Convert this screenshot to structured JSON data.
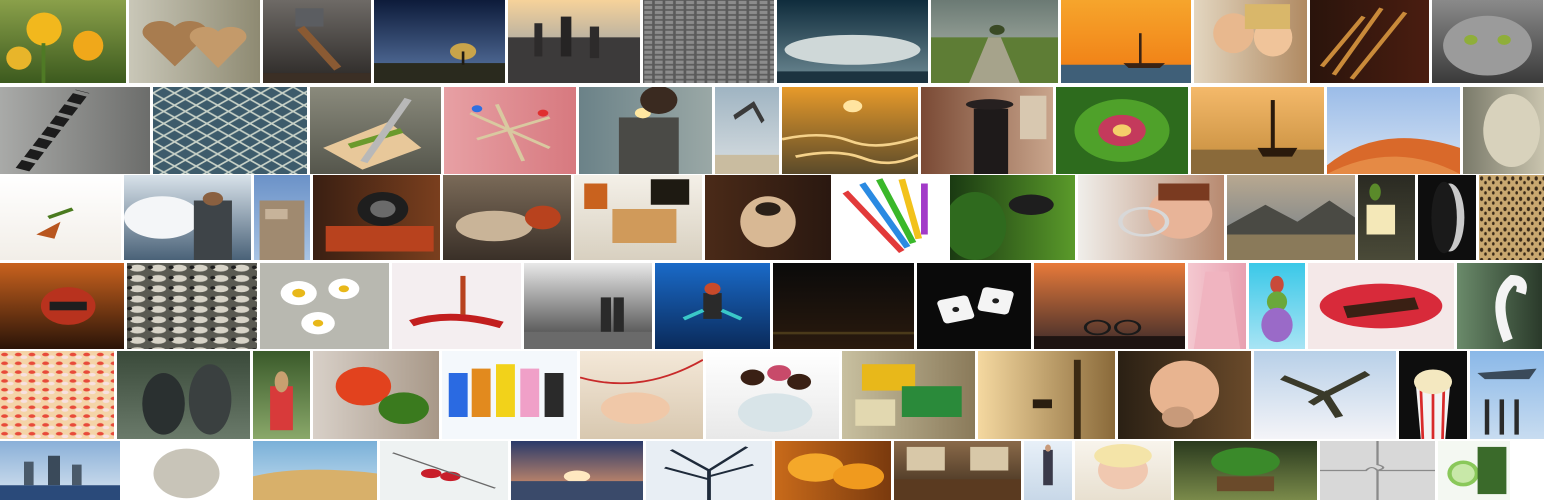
{
  "mosaic": {
    "subjects": [
      [
        "yellow-tulips",
        "wooden-hearts",
        "hammer",
        "tree-under-night-sky",
        "city-skyline-sunset",
        "typeset-letters",
        "stormy-sky",
        "tree-on-field-path",
        "sailing-ship-sunset",
        "two-women-whispering",
        "wheat-ears",
        "cat-face"
      ],
      [
        "chain-links",
        "chain-link-fence",
        "sandwich-with-caliper",
        "safety-pins-on-pink",
        "woman-with-sparkler",
        "man-jumping-on-beach",
        "winding-river-sunset",
        "woman-with-hat-on-stairs",
        "green-kale",
        "tall-ship-sunset",
        "red-desert-dune",
        "lion-statue"
      ],
      [
        "falling-leaf",
        "men-in-boat-splashing",
        "stacked-stones",
        "vintage-camera",
        "sleeping-kittens",
        "toast-and-spreads",
        "pug-puppy",
        "colored-pencils",
        "butterfly-on-leaf",
        "girl-with-magnifier",
        "mountain-valley",
        "cheese-and-nuts",
        "woman-black-and-white",
        "leopard"
      ],
      [
        "motorcycle-helmet-rider",
        "flock-of-sheep",
        "daisies",
        "red-chili-peppers",
        "couple-on-stormy-beach",
        "scuba-diver",
        "dark-horizon",
        "dice",
        "bicycle-silhouette-sunset",
        "pink-dress",
        "stacked-sea-urchins",
        "lips-biting-chocolate",
        "swan"
      ],
      [
        "flower-petals",
        "stone-statues",
        "dog-in-costume",
        "tomato-and-parsley",
        "thread-spools-and-needle",
        "hands-sewing",
        "cake-pops-in-glass",
        "matchboxes",
        "deer-in-misty-forest",
        "woman-smiling",
        "skydiver",
        "popcorn",
        "military-parade"
      ],
      [
        "city-skyline-water",
        "marble-statue",
        "desert-dunes",
        "red-berries-on-snow",
        "sunset-over-water",
        "bare-tree-branches",
        "orange-halves",
        "cafe-interior",
        "woman-walking",
        "blonde-woman-portrait",
        "tree-on-stump",
        "puzzle-pieces",
        "cucumber-slices"
      ]
    ]
  }
}
